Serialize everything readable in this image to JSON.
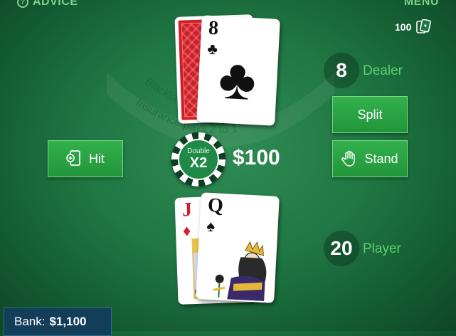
{
  "topbar": {
    "advice_label": "ADVICE",
    "menu_label": "MENU",
    "deck_count": "100"
  },
  "felt": {
    "line1": "Insurance pays 2 to 1",
    "line2": "Blackjack pays 3 to 2"
  },
  "dealer": {
    "score": "8",
    "label": "Dealer",
    "cards": [
      {
        "face": "down"
      },
      {
        "rank": "8",
        "suit": "♣",
        "color": "#111111"
      }
    ]
  },
  "player": {
    "score": "20",
    "label": "Player",
    "cards": [
      {
        "rank": "J",
        "suit": "♦",
        "color": "#d41e2b"
      },
      {
        "rank": "Q",
        "suit": "♠",
        "color": "#111111"
      }
    ]
  },
  "actions": {
    "hit_label": "Hit",
    "split_label": "Split",
    "stand_label": "Stand"
  },
  "bet": {
    "chip_sub": "Double",
    "chip_main": "X2",
    "amount": "$100"
  },
  "bank": {
    "label": "Bank:",
    "value": "$1,100"
  },
  "colors": {
    "felt": "#1f7743",
    "accent_green": "#5ed072",
    "button": "#2aa444",
    "bank_bg": "#123e59"
  }
}
